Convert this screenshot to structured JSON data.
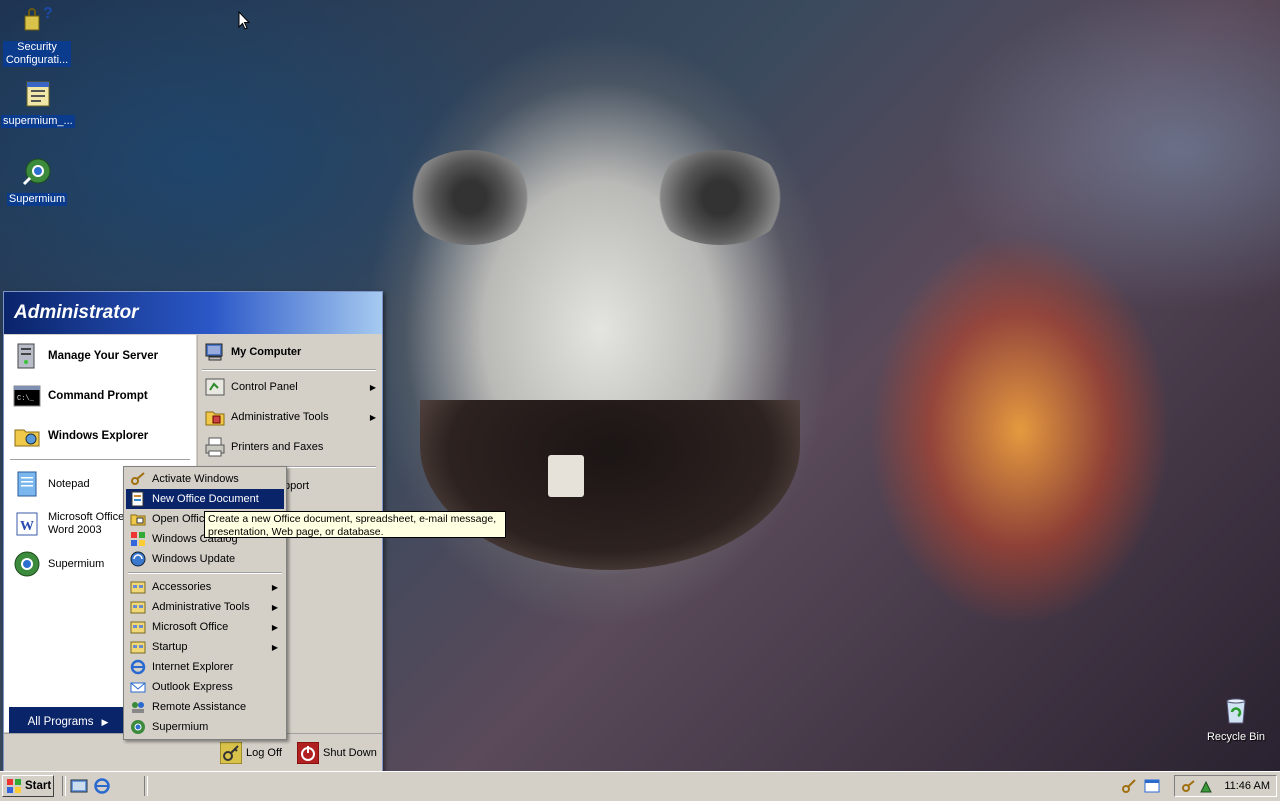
{
  "desktop": {
    "icons": [
      {
        "label": "Security Configurati..."
      },
      {
        "label": "supermium_..."
      },
      {
        "label": "Supermium"
      },
      {
        "label": "Recycle Bin"
      }
    ]
  },
  "start_menu": {
    "user": "Administrator",
    "pinned": [
      {
        "label": "Manage Your Server"
      },
      {
        "label": "Command Prompt"
      },
      {
        "label": "Windows Explorer"
      }
    ],
    "recent": [
      {
        "label": "Notepad"
      },
      {
        "label": "Microsoft Office Word 2003"
      },
      {
        "label": "Supermium"
      }
    ],
    "right_items": [
      {
        "label": "My Computer"
      },
      {
        "label": "Control Panel"
      },
      {
        "label": "Administrative Tools"
      },
      {
        "label": "Printers and Faxes"
      },
      {
        "label": "pport"
      }
    ],
    "all_programs": "All Programs",
    "log_off": "Log Off",
    "shut_down": "Shut Down"
  },
  "programs_menu": {
    "items": [
      {
        "label": "Activate Windows"
      },
      {
        "label": "New Office Document"
      },
      {
        "label": "Open Offic"
      },
      {
        "label": "Windows Catalog"
      },
      {
        "label": "Windows Update"
      },
      {
        "label": "Accessories"
      },
      {
        "label": "Administrative Tools"
      },
      {
        "label": "Microsoft Office"
      },
      {
        "label": "Startup"
      },
      {
        "label": "Internet Explorer"
      },
      {
        "label": "Outlook Express"
      },
      {
        "label": "Remote Assistance"
      },
      {
        "label": "Supermium"
      }
    ]
  },
  "tooltip": {
    "line1": "Create a new Office document, spreadsheet, e-mail message,",
    "line2": "presentation, Web page, or database."
  },
  "taskbar": {
    "start_label": "Start",
    "clock": "11:46 AM"
  },
  "colors": {
    "selection": "#0a246a",
    "menu_bg": "#d4d0c8",
    "tooltip_bg": "#ffffe1"
  }
}
